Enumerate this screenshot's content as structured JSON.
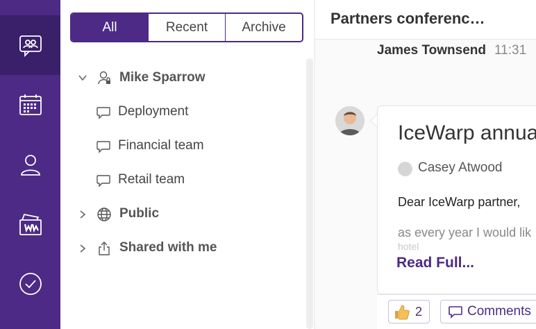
{
  "rail": {
    "items": [
      {
        "icon": "chat-icon",
        "active": true
      },
      {
        "icon": "calendar-icon",
        "active": false
      },
      {
        "icon": "contact-icon",
        "active": false
      },
      {
        "icon": "files-icon",
        "active": false
      },
      {
        "icon": "tasks-icon",
        "active": false
      }
    ]
  },
  "filter": {
    "tabs": [
      "All",
      "Recent",
      "Archive"
    ],
    "active": "All"
  },
  "tree": {
    "owner": "Mike Sparrow",
    "rooms": [
      "Deployment",
      "Financial team",
      "Retail team"
    ],
    "public": "Public",
    "shared": "Shared with me"
  },
  "chat": {
    "title": "Partners conferenc…",
    "message": {
      "sender": "James Townsend",
      "time": "11:31",
      "card_title": "IceWarp annua",
      "author": "Casey Atwood",
      "greeting": "Dear IceWarp partner,",
      "body": "as every year I would lik",
      "body_cut": "hotel",
      "read_more": "Read Full..."
    },
    "likes": "2",
    "comments_label": "Comments"
  },
  "colors": {
    "brand": "#4c2a86",
    "rail_active": "#3a1f6b"
  }
}
